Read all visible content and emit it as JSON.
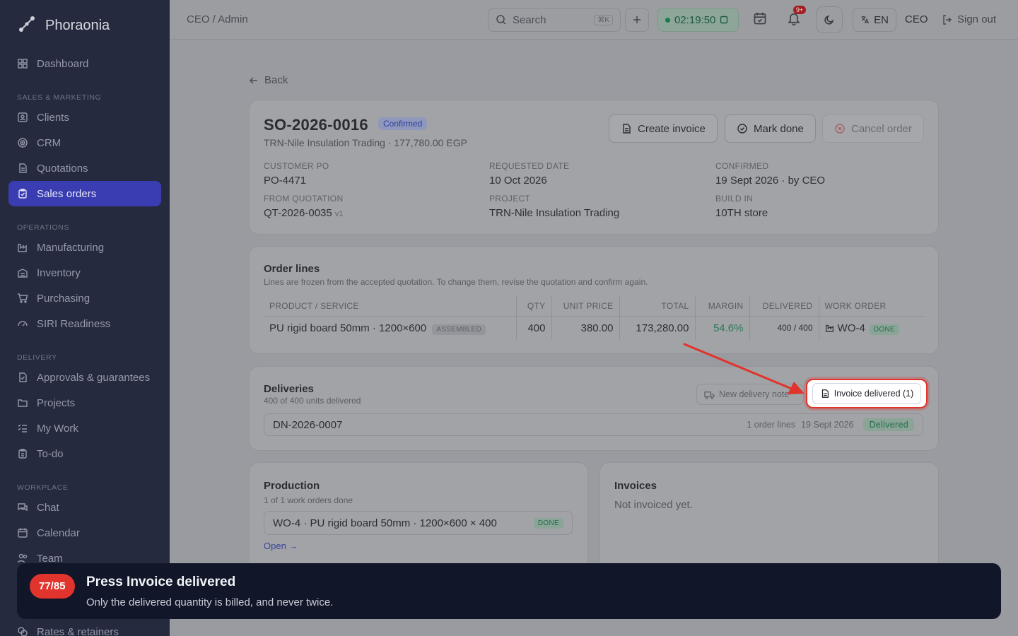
{
  "app": {
    "name": "Phoraonia"
  },
  "sidebar": {
    "top": [
      {
        "label": "Dashboard"
      }
    ],
    "sections": [
      {
        "title": "SALES & MARKETING",
        "items": [
          "Clients",
          "CRM",
          "Quotations",
          "Sales orders"
        ]
      },
      {
        "title": "OPERATIONS",
        "items": [
          "Manufacturing",
          "Inventory",
          "Purchasing",
          "SIRI Readiness"
        ]
      },
      {
        "title": "DELIVERY",
        "items": [
          "Approvals & guarantees",
          "Projects",
          "My Work",
          "To-do"
        ]
      },
      {
        "title": "WORKPLACE",
        "items": [
          "Chat",
          "Calendar",
          "Team"
        ]
      }
    ],
    "active": "Sales orders",
    "bottom_item": "Rates & retainers"
  },
  "topbar": {
    "breadcrumb": "CEO / Admin",
    "search_placeholder": "Search",
    "search_shortcut": "⌘K",
    "timer": "02:19:50",
    "notification_count": "9+",
    "language": "EN",
    "role": "CEO",
    "signout": "Sign out"
  },
  "page": {
    "back": "Back",
    "order": {
      "number": "SO-2026-0016",
      "status": "Confirmed",
      "subtitle": "TRN-Nile Insulation Trading · 177,780.00 EGP",
      "actions": {
        "create_invoice": "Create invoice",
        "mark_done": "Mark done",
        "cancel": "Cancel order"
      },
      "fields": {
        "customer_po_label": "CUSTOMER PO",
        "customer_po": "PO-4471",
        "requested_label": "REQUESTED DATE",
        "requested": "10 Oct 2026",
        "confirmed_label": "CONFIRMED",
        "confirmed": "19 Sept 2026 · by CEO",
        "quotation_label": "FROM QUOTATION",
        "quotation": "QT-2026-0035",
        "quotation_version": "v1",
        "project_label": "PROJECT",
        "project": "TRN-Nile Insulation Trading",
        "build_label": "BUILD IN",
        "build": "10TH store"
      }
    },
    "order_lines": {
      "title": "Order lines",
      "note": "Lines are frozen from the accepted quotation. To change them, revise the quotation and confirm again.",
      "headers": [
        "PRODUCT / SERVICE",
        "QTY",
        "UNIT PRICE",
        "TOTAL",
        "MARGIN",
        "DELIVERED",
        "WORK ORDER"
      ],
      "rows": [
        {
          "product": "PU rigid board 50mm · 1200×600",
          "tag": "ASSEMBLED",
          "qty": "400",
          "unit_price": "380.00",
          "total": "173,280.00",
          "margin": "54.6%",
          "delivered": "400 / 400",
          "work_order": "WO-4",
          "wo_status": "DONE"
        }
      ]
    },
    "deliveries": {
      "title": "Deliveries",
      "subtitle": "400 of 400 units delivered",
      "new_button": "New delivery note",
      "invoice_button": "Invoice delivered (1)",
      "rows": [
        {
          "number": "DN-2026-0007",
          "lines": "1 order lines",
          "date": "19 Sept 2026",
          "status": "Delivered"
        }
      ]
    },
    "production": {
      "title": "Production",
      "subtitle": "1 of 1 work orders done",
      "item": "WO-4 · PU rigid board 50mm · 1200×600 × 400",
      "item_status": "DONE",
      "open": "Open →"
    },
    "invoices": {
      "title": "Invoices",
      "empty": "Not invoiced yet."
    }
  },
  "tour": {
    "step": "77/85",
    "title": "Press Invoice delivered",
    "subtitle": "Only the delivered quantity is billed, and never twice."
  }
}
